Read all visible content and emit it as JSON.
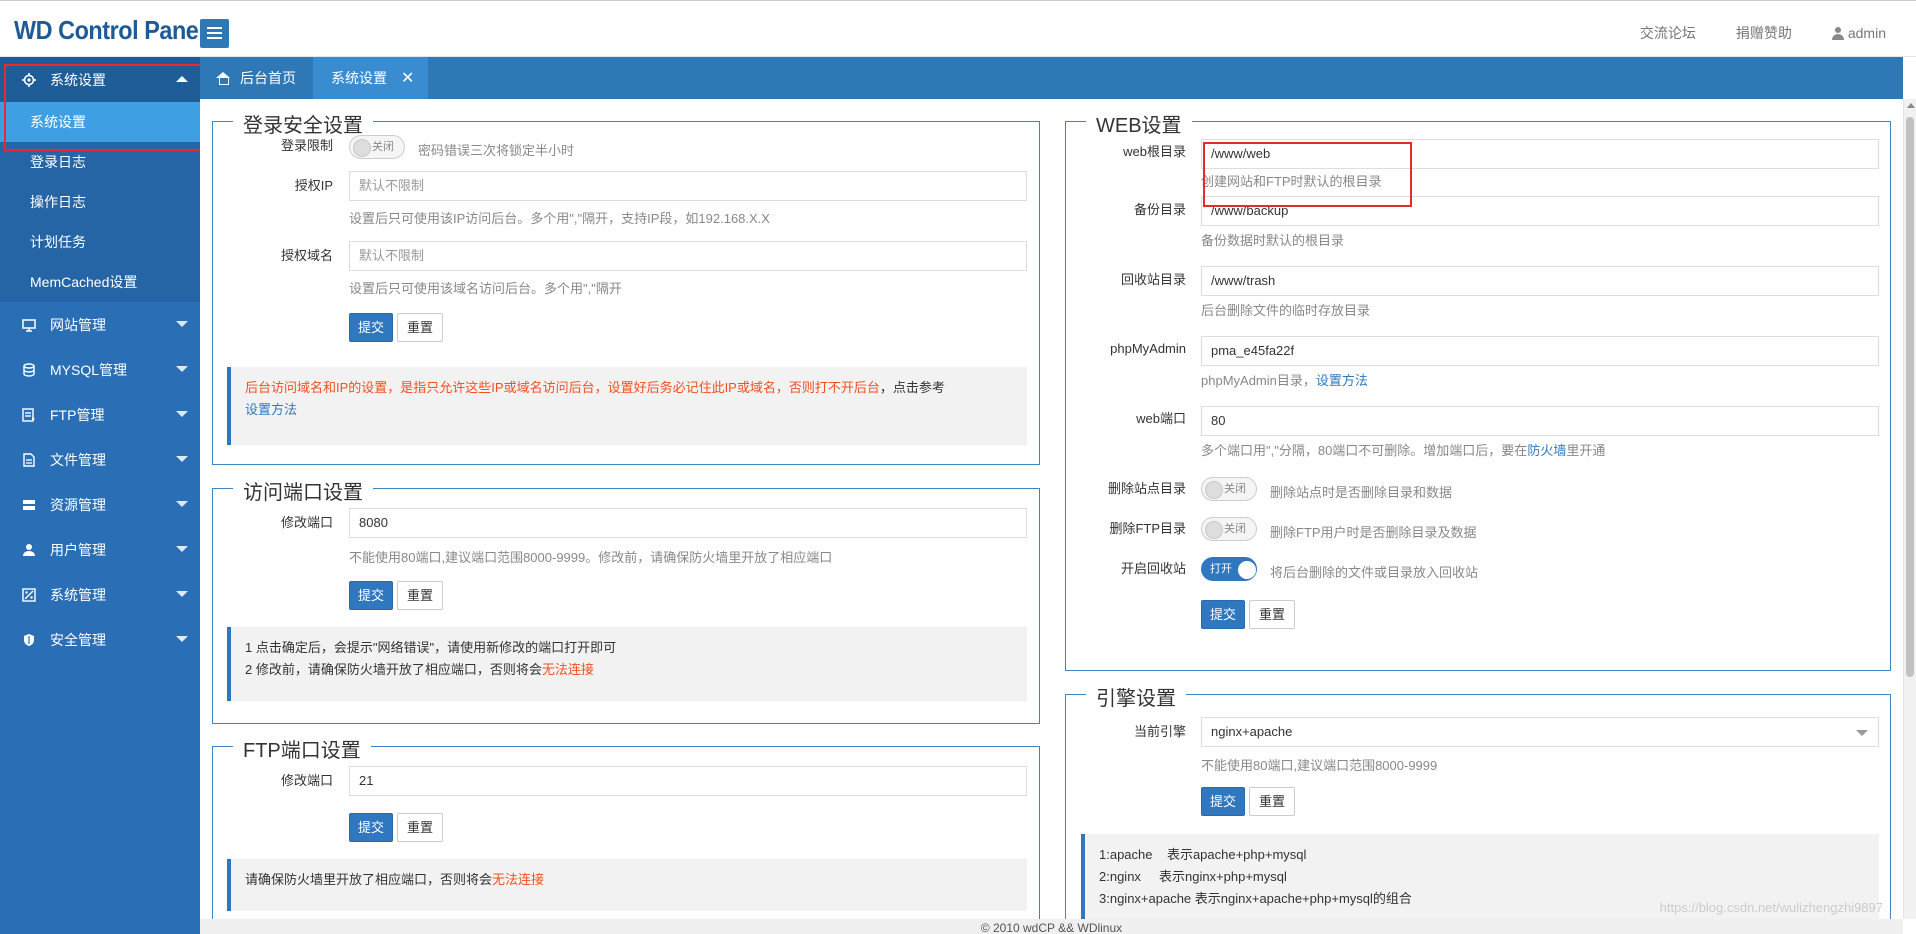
{
  "header": {
    "logo": "WD Control Panel",
    "links": [
      "交流论坛",
      "捐赠赞助"
    ],
    "user": "admin"
  },
  "sidebar": {
    "groups": [
      {
        "label": "系统设置",
        "icon": "gear-icon",
        "expanded": true,
        "items": [
          "系统设置",
          "登录日志",
          "操作日志",
          "计划任务",
          "MemCached设置"
        ]
      },
      {
        "label": "网站管理",
        "icon": "monitor-icon"
      },
      {
        "label": "MYSQL管理",
        "icon": "database-icon"
      },
      {
        "label": "FTP管理",
        "icon": "ftp-icon"
      },
      {
        "label": "文件管理",
        "icon": "file-icon"
      },
      {
        "label": "资源管理",
        "icon": "server-icon"
      },
      {
        "label": "用户管理",
        "icon": "user-icon"
      },
      {
        "label": "系统管理",
        "icon": "system-icon"
      },
      {
        "label": "安全管理",
        "icon": "shield-icon"
      }
    ]
  },
  "tabs": [
    {
      "label": "后台首页"
    },
    {
      "label": "系统设置"
    }
  ],
  "buttons": {
    "submit": "提交",
    "reset": "重置"
  },
  "login_security": {
    "title": "登录安全设置",
    "limit_label": "登录限制",
    "limit_state": "关闭",
    "limit_help": "密码错误三次将锁定半小时",
    "ip_label": "授权IP",
    "ip_placeholder": "默认不限制",
    "ip_help": "设置后只可使用该IP访问后台。多个用\",\"隔开，支持IP段，如192.168.X.X",
    "domain_label": "授权域名",
    "domain_placeholder": "默认不限制",
    "domain_help": "设置后只可使用该域名访问后台。多个用\",\"隔开",
    "note_orange": "后台访问域名和IP的设置，是指只允许这些IP或域名访问后台，设置好后务必记住此IP或域名，否则打不开后台",
    "note_tail": "，点击参考",
    "note_link": "设置方法"
  },
  "access_port": {
    "title": "访问端口设置",
    "port_label": "修改端口",
    "port_value": "8080",
    "help": "不能使用80端口,建议端口范围8000-9999。修改前，请确保防火墙里开放了相应端口",
    "note1": "1 点击确定后，会提示\"网络错误\"，请使用新修改的端口打开即可",
    "note2_prefix": "2 修改前，请确保防火墙开放了相应端口，否则将会",
    "note2_orange": "无法连接"
  },
  "ftp_port": {
    "title": "FTP端口设置",
    "port_label": "修改端口",
    "port_value": "21",
    "note_prefix": "请确保防火墙里开放了相应端口，否则将会",
    "note_orange": "无法连接"
  },
  "web": {
    "title": "WEB设置",
    "root_label": "web根目录",
    "root_value": "/www/web",
    "root_help": "创建网站和FTP时默认的根目录",
    "backup_label": "备份目录",
    "backup_value": "/www/backup",
    "backup_help": "备份数据时默认的根目录",
    "trash_label": "回收站目录",
    "trash_value": "/www/trash",
    "trash_help": "后台删除文件的临时存放目录",
    "pma_label": "phpMyAdmin",
    "pma_value": "pma_e45fa22f",
    "pma_help": "phpMyAdmin目录，",
    "pma_link": "设置方法",
    "port_label": "web端口",
    "port_value": "80",
    "port_help": "多个端口用\",\"分隔，80端口不可删除。增加端口后，要在",
    "port_link": "防火墙",
    "port_help_tail": "里开通",
    "del_site_label": "删除站点目录",
    "del_site_state": "关闭",
    "del_site_help": "删除站点时是否删除目录和数据",
    "del_ftp_label": "删除FTP目录",
    "del_ftp_state": "关闭",
    "del_ftp_help": "删除FTP用户时是否删除目录及数据",
    "recycle_label": "开启回收站",
    "recycle_state": "打开",
    "recycle_help": "将后台删除的文件或目录放入回收站"
  },
  "engine": {
    "title": "引擎设置",
    "label": "当前引擎",
    "value": "nginx+apache",
    "help": "不能使用80端口,建议端口范围8000-9999",
    "note1": "1:apache    表示apache+php+mysql",
    "note2": "2:nginx     表示nginx+php+mysql",
    "note3": "3:nginx+apache 表示nginx+apache+php+mysql的组合"
  },
  "footer": "© 2010 wdCP && WDlinux",
  "watermark": "https://blog.csdn.net/wulizhengzhi9897",
  "colors": {
    "primary": "#2f78b6",
    "sidebar": "#2a6fb5",
    "active_item": "#3ea0e3",
    "highlight": "#e52b2b",
    "warning": "#f2501f"
  }
}
